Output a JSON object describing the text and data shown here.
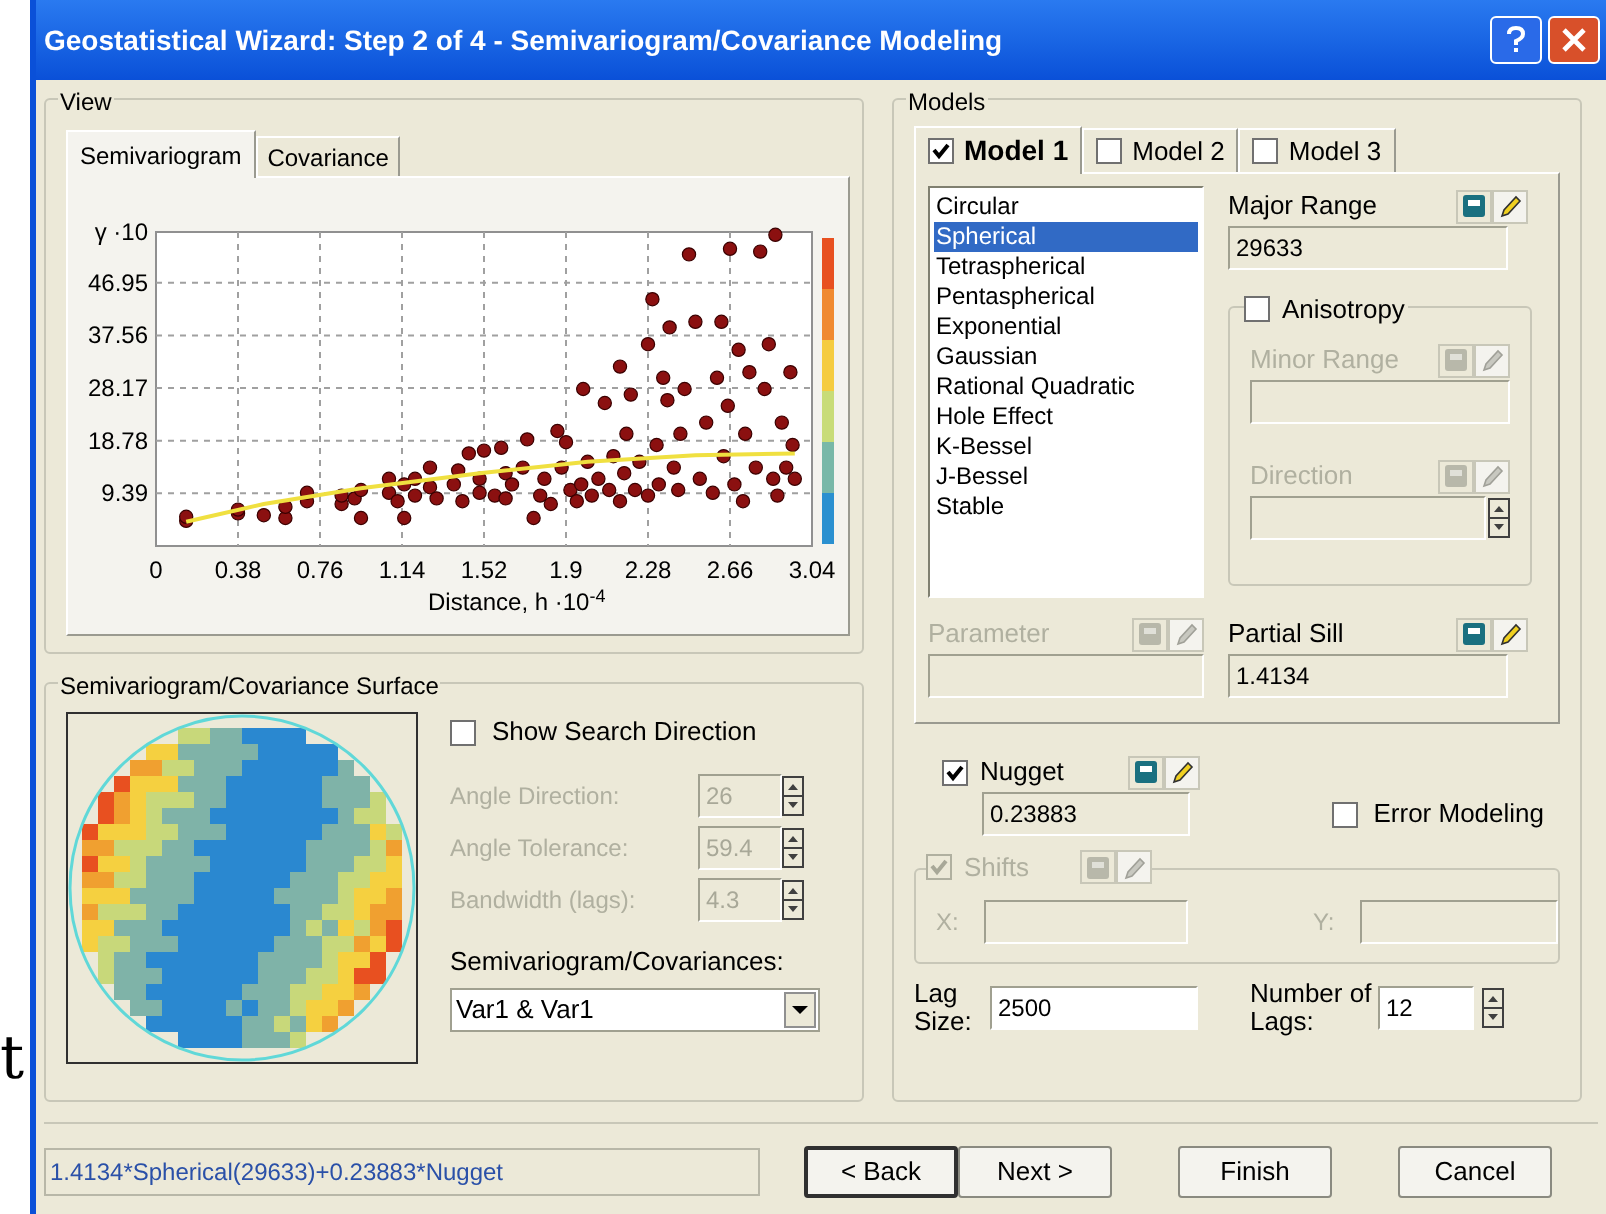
{
  "background_text": "t",
  "window": {
    "title": "Geostatistical Wizard: Step 2 of 4 - Semivariogram/Covariance Modeling"
  },
  "view": {
    "title": "View",
    "tabs": [
      {
        "label": "Semivariogram",
        "selected": true
      },
      {
        "label": "Covariance",
        "selected": false
      }
    ],
    "chart_data": {
      "type": "scatter",
      "xlabel": "Distance, h ·10$^{-4}$",
      "ylabel": "γ ·10",
      "xlim": [
        0,
        3.04
      ],
      "ylim": [
        0,
        56
      ],
      "xticks": [
        0,
        0.38,
        0.76,
        1.14,
        1.52,
        1.9,
        2.28,
        2.66,
        3.04
      ],
      "yticks": [
        9.39,
        18.78,
        28.17,
        37.56,
        46.95
      ],
      "grid": true,
      "x": [
        0.14,
        0.14,
        0.38,
        0.38,
        0.5,
        0.6,
        0.6,
        0.7,
        0.7,
        0.86,
        0.86,
        0.92,
        0.95,
        0.95,
        1.08,
        1.08,
        1.12,
        1.15,
        1.15,
        1.2,
        1.2,
        1.27,
        1.27,
        1.3,
        1.38,
        1.4,
        1.42,
        1.45,
        1.5,
        1.5,
        1.52,
        1.57,
        1.6,
        1.62,
        1.62,
        1.65,
        1.7,
        1.72,
        1.75,
        1.78,
        1.8,
        1.83,
        1.86,
        1.88,
        1.9,
        1.92,
        1.95,
        1.97,
        1.98,
        2.0,
        2.02,
        2.05,
        2.08,
        2.1,
        2.12,
        2.15,
        2.15,
        2.17,
        2.18,
        2.2,
        2.22,
        2.24,
        2.28,
        2.28,
        2.3,
        2.32,
        2.33,
        2.35,
        2.37,
        2.38,
        2.4,
        2.42,
        2.43,
        2.45,
        2.47,
        2.5,
        2.52,
        2.55,
        2.58,
        2.6,
        2.62,
        2.63,
        2.65,
        2.66,
        2.68,
        2.7,
        2.72,
        2.73,
        2.75,
        2.78,
        2.8,
        2.82,
        2.84,
        2.86,
        2.87,
        2.88,
        2.9,
        2.92,
        2.94,
        2.95,
        2.96
      ],
      "series": [
        {
          "color": "#8b1010",
          "values": [
            4.5,
            5.2,
            5.8,
            6.5,
            5.5,
            5,
            7,
            8,
            9.5,
            7.5,
            9,
            8.5,
            10,
            5,
            9.5,
            12,
            8,
            11,
            5,
            9,
            12,
            10.5,
            14,
            8.5,
            11,
            13.5,
            8,
            16.5,
            9.5,
            12,
            17,
            9,
            17.5,
            13,
            8.5,
            11,
            14,
            19,
            5,
            9,
            12,
            7.5,
            20.5,
            14,
            18.5,
            10,
            8,
            11,
            28,
            15,
            9,
            12,
            25.5,
            10,
            16,
            32,
            8,
            13,
            20,
            27,
            10,
            15,
            36,
            9,
            44,
            18,
            11,
            30,
            26,
            39,
            14,
            10,
            20,
            28,
            52,
            40,
            12,
            22,
            9.5,
            30,
            40,
            16,
            25,
            53,
            11,
            35,
            8,
            20,
            31,
            14,
            52.5,
            28,
            36,
            12,
            55.5,
            9,
            22,
            14,
            31,
            18,
            12
          ]
        },
        {
          "type": "line",
          "color": "#f0e040",
          "values": [
            4.3,
            null,
            null,
            null,
            7.5,
            null,
            null,
            null,
            null,
            null,
            null,
            null,
            10.3,
            null,
            null,
            null,
            null,
            null,
            null,
            null,
            null,
            null,
            null,
            null,
            null,
            null,
            null,
            null,
            13,
            null,
            null,
            null,
            null,
            null,
            null,
            null,
            null,
            null,
            null,
            null,
            null,
            null,
            null,
            null,
            null,
            null,
            null,
            null,
            null,
            15,
            null,
            null,
            null,
            null,
            null,
            null,
            null,
            null,
            null,
            null,
            null,
            null,
            null,
            null,
            null,
            null,
            null,
            null,
            null,
            null,
            null,
            null,
            null,
            null,
            null,
            16.2,
            null,
            null,
            null,
            null,
            null,
            null,
            null,
            null,
            null,
            null,
            null,
            null,
            null,
            null,
            null,
            null,
            null,
            null,
            null,
            null,
            null,
            null,
            null,
            null,
            16.5
          ]
        }
      ]
    }
  },
  "surface": {
    "title": "Semivariogram/Covariance Surface",
    "show_search_direction": {
      "label": "Show Search Direction",
      "checked": false
    },
    "fields": [
      {
        "label": "Angle Direction:",
        "value": "26",
        "disabled": true
      },
      {
        "label": "Angle Tolerance:",
        "value": "59.4",
        "disabled": true
      },
      {
        "label": "Bandwidth (lags):",
        "value": "4.3",
        "disabled": true
      }
    ],
    "dropdown_label": "Semivariogram/Covariances:",
    "dropdown_value": "Var1 & Var1"
  },
  "models": {
    "title": "Models",
    "tabs": [
      {
        "label": "Model 1",
        "checked": true,
        "selected": true
      },
      {
        "label": "Model 2",
        "checked": false,
        "selected": false
      },
      {
        "label": "Model 3",
        "checked": false,
        "selected": false
      }
    ],
    "types": [
      {
        "label": "Circular",
        "selected": false
      },
      {
        "label": "Spherical",
        "selected": true
      },
      {
        "label": "Tetraspherical",
        "selected": false
      },
      {
        "label": "Pentaspherical",
        "selected": false
      },
      {
        "label": "Exponential",
        "selected": false
      },
      {
        "label": "Gaussian",
        "selected": false
      },
      {
        "label": "Rational Quadratic",
        "selected": false
      },
      {
        "label": "Hole Effect",
        "selected": false
      },
      {
        "label": "K-Bessel",
        "selected": false
      },
      {
        "label": "J-Bessel",
        "selected": false
      },
      {
        "label": "Stable",
        "selected": false
      }
    ],
    "major_range": {
      "label": "Major Range",
      "value": "29633",
      "disabled": false
    },
    "anisotropy": {
      "label": "Anisotropy",
      "checked": false
    },
    "minor_range": {
      "label": "Minor Range",
      "disabled": true
    },
    "direction": {
      "label": "Direction",
      "disabled": true
    },
    "parameter": {
      "label": "Parameter",
      "disabled": true
    },
    "partial_sill": {
      "label": "Partial Sill",
      "value": "1.4134",
      "disabled": false
    },
    "nugget": {
      "label": "Nugget",
      "checked": true,
      "value": "0.23883"
    },
    "error_modeling": {
      "label": "Error Modeling",
      "checked": false
    },
    "shifts": {
      "label": "Shifts",
      "checked": true,
      "disabled": true,
      "x_label": "X:",
      "y_label": "Y:"
    },
    "lag_size": {
      "label": "Lag Size:",
      "value": "2500"
    },
    "number_of_lags": {
      "label": "Number of Lags:",
      "value": "12"
    }
  },
  "formula": "1.4134*Spherical(29633)+0.23883*Nugget",
  "buttons": [
    {
      "label": "< Back"
    },
    {
      "label": "Next >"
    },
    {
      "label": "Finish"
    },
    {
      "label": "Cancel"
    }
  ]
}
